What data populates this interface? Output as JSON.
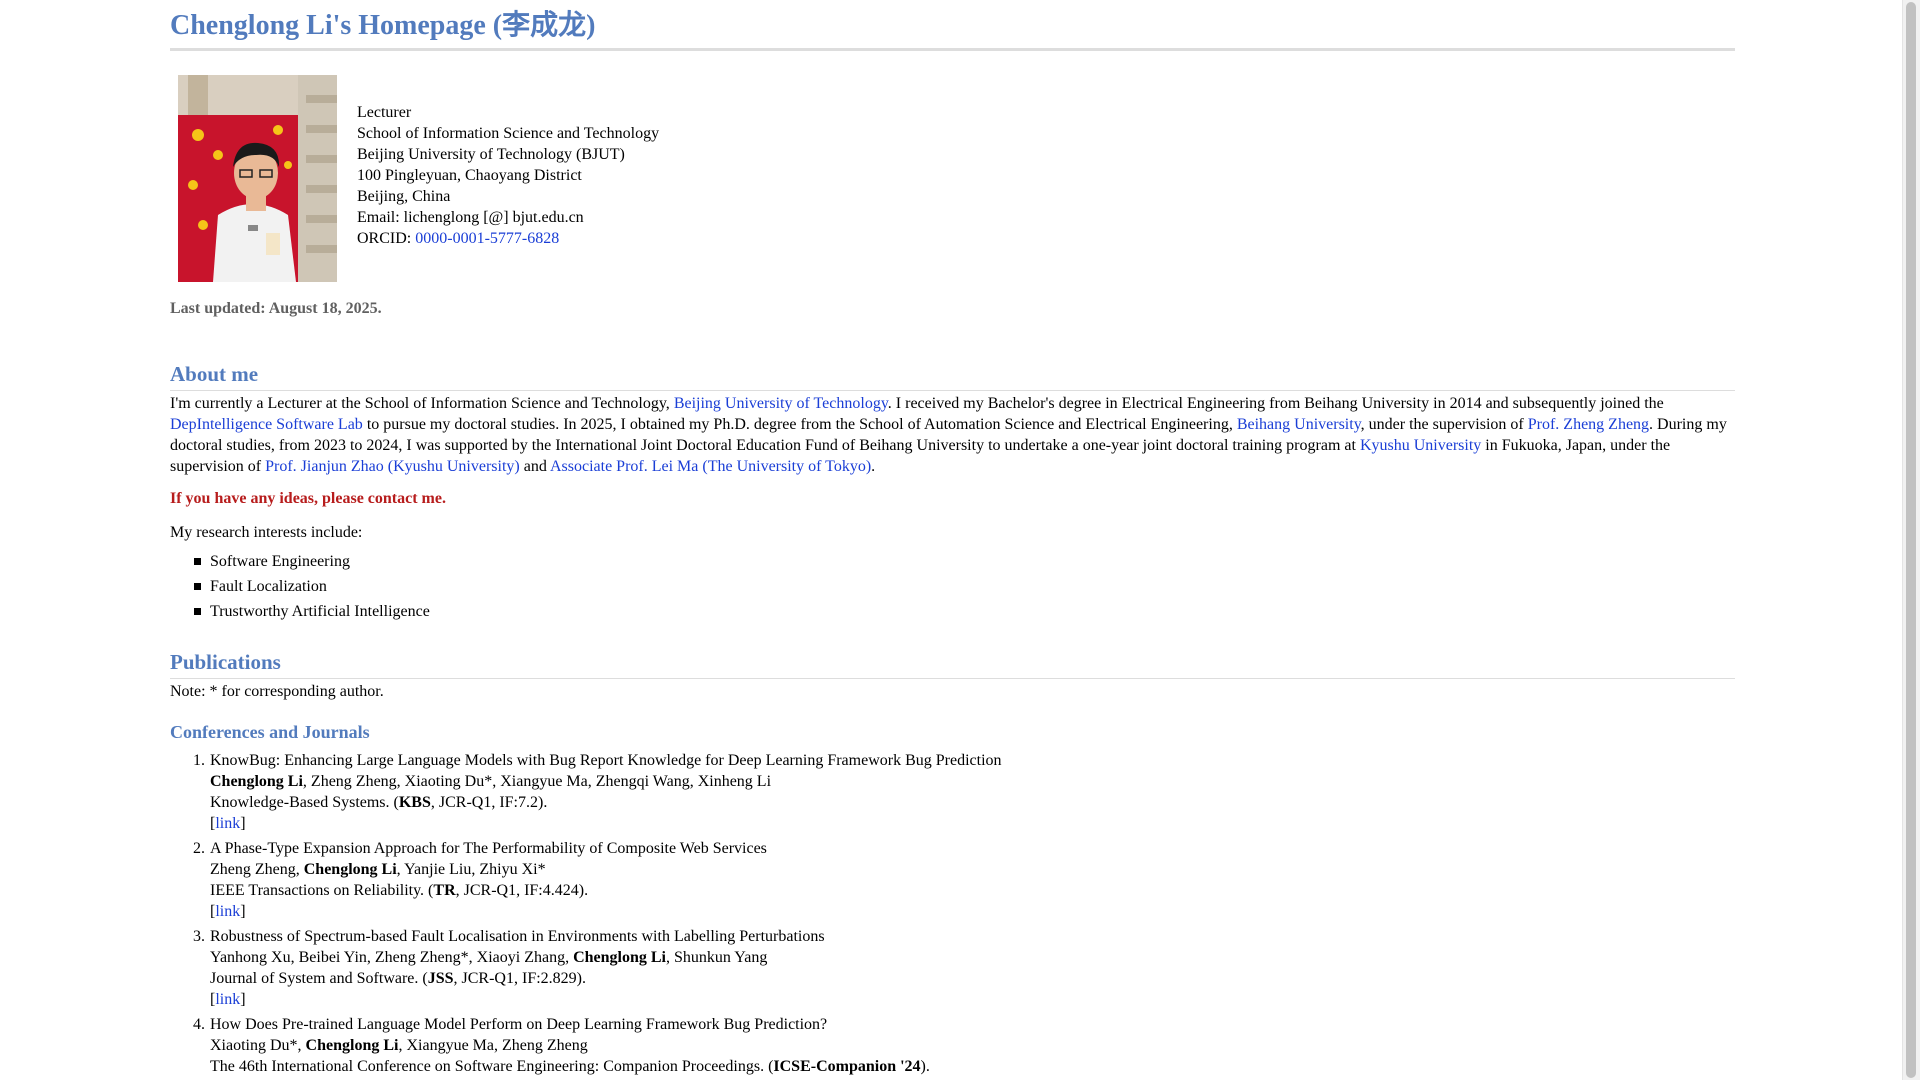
{
  "page": {
    "title": "Chenglong Li's Homepage (李成龙)"
  },
  "profile": {
    "role": "Lecturer",
    "school": "School of Information Science and Technology",
    "university": "Beijing University of Technology (BJUT)",
    "address": "100 Pingleyuan, Chaoyang District",
    "city": "Beijing, China",
    "email": "Email: lichenglong [@] bjut.edu.cn",
    "orcid_label": "ORCID: ",
    "orcid_value": "0000-0001-5777-6828"
  },
  "last_updated": "Last updated: August 18, 2025.",
  "about": {
    "heading": "About me",
    "p1": "I'm currently a Lecturer at the School of Information Science and Technology, ",
    "link_bjut": "Beijing University of Technology",
    "p2": ". I received my Bachelor's degree in Electrical Engineering from Beihang University in 2014 and subsequently joined the",
    "link_lab": "DepIntelligence Software Lab",
    "p3": " to pursue my doctoral studies. In 2025, I obtained my Ph.D. degree from the School of Automation Science and Electrical Engineering, ",
    "link_beihang": "Beihang University",
    "p4": ", under the supervision of ",
    "link_zheng": "Prof. Zheng Zheng",
    "p5": ". During my",
    "p6": "doctoral studies, from 2023 to 2024, I was supported by the International Joint Doctoral Education Fund of Beihang University to undertake a one-year joint doctoral training program at ",
    "link_kyushu": "Kyushu University",
    "p7": " in Fukuoka, Japan, under the",
    "p8": "supervision of ",
    "link_zhao": "Prof. Jianjun Zhao (Kyushu University)",
    "p9": " and ",
    "link_ma": "Associate Prof. Lei Ma (The University of Tokyo)",
    "p10": ".",
    "contact_me": "If you have any ideas, please contact me.",
    "interests_intro": "My research interests include:",
    "interests": [
      "Software Engineering",
      "Fault Localization",
      "Trustworthy Artificial Intelligence"
    ]
  },
  "publications": {
    "heading": "Publications",
    "note": "Note: * for corresponding author.",
    "conf_heading": "Conferences and Journals",
    "link_label": "link",
    "items": [
      {
        "num": "1.",
        "title": "KnowBug: Enhancing Large Language Models with Bug Report Knowledge for Deep Learning Framework Bug Prediction",
        "authors_pre": "",
        "authors_bold": "Chenglong Li",
        "authors_post": ", Zheng Zheng, Xiaoting Du*, Xiangyue Ma, Zhengqi Wang, Xinheng Li",
        "venue_pre": "Knowledge-Based Systems. (",
        "venue_bold": "KBS",
        "venue_post": ", JCR-Q1, IF:7.2)."
      },
      {
        "num": "2.",
        "title": "A Phase-Type Expansion Approach for The Performability of Composite Web Services",
        "authors_pre": "Zheng Zheng, ",
        "authors_bold": "Chenglong Li",
        "authors_post": ", Yanjie Liu, Zhiyu Xi*",
        "venue_pre": "IEEE Transactions on Reliability. (",
        "venue_bold": "TR",
        "venue_post": ", JCR-Q1, IF:4.424)."
      },
      {
        "num": "3.",
        "title": "Robustness of Spectrum-based Fault Localisation in Environments with Labelling Perturbations",
        "authors_pre": "Yanhong Xu, Beibei Yin, Zheng Zheng*, Xiaoyi Zhang, ",
        "authors_bold": "Chenglong Li",
        "authors_post": ", Shunkun Yang",
        "venue_pre": "Journal of System and Software. (",
        "venue_bold": "JSS",
        "venue_post": ", JCR-Q1, IF:2.829)."
      },
      {
        "num": "4.",
        "title": "How Does Pre-trained Language Model Perform on Deep Learning Framework Bug Prediction?",
        "authors_pre": "Xiaoting Du*, ",
        "authors_bold": "Chenglong Li",
        "authors_post": ", Xiangyue Ma, Zheng Zheng",
        "venue_pre": "The 46th International Conference on Software Engineering: Companion Proceedings. (",
        "venue_bold": "ICSE-Companion '24",
        "venue_post": ")."
      }
    ]
  }
}
